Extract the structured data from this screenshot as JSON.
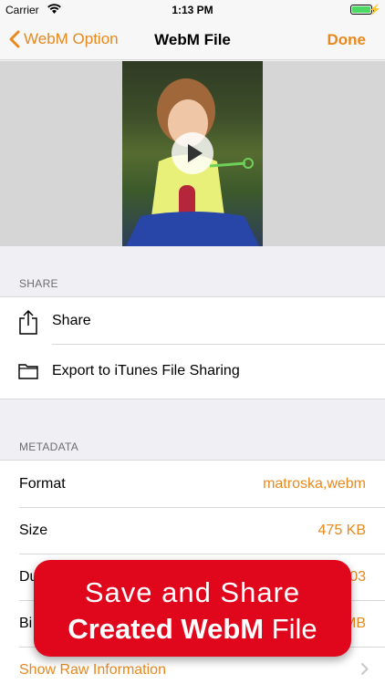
{
  "status_bar": {
    "carrier": "Carrier",
    "time": "1:13 PM"
  },
  "nav": {
    "back_label": "WebM Option",
    "title": "WebM File",
    "done_label": "Done"
  },
  "share_section": {
    "header": "SHARE",
    "items": [
      {
        "label": "Share",
        "icon": "share-icon"
      },
      {
        "label": "Export to iTunes File Sharing",
        "icon": "folder-icon"
      }
    ]
  },
  "metadata_section": {
    "header": "METADATA",
    "rows": [
      {
        "label": "Format",
        "value": "matroska,webm"
      },
      {
        "label": "Size",
        "value": "475 KB"
      },
      {
        "label": "Du",
        "value": "03"
      },
      {
        "label": "Bi",
        "value": "MB"
      }
    ],
    "raw_link": "Show Raw Information"
  },
  "promo": {
    "line1": "Save and Share",
    "line2_bold": "Created WebM",
    "line2_rest": " File"
  },
  "colors": {
    "accent": "#e8891f",
    "promo_red": "#e0061c"
  }
}
